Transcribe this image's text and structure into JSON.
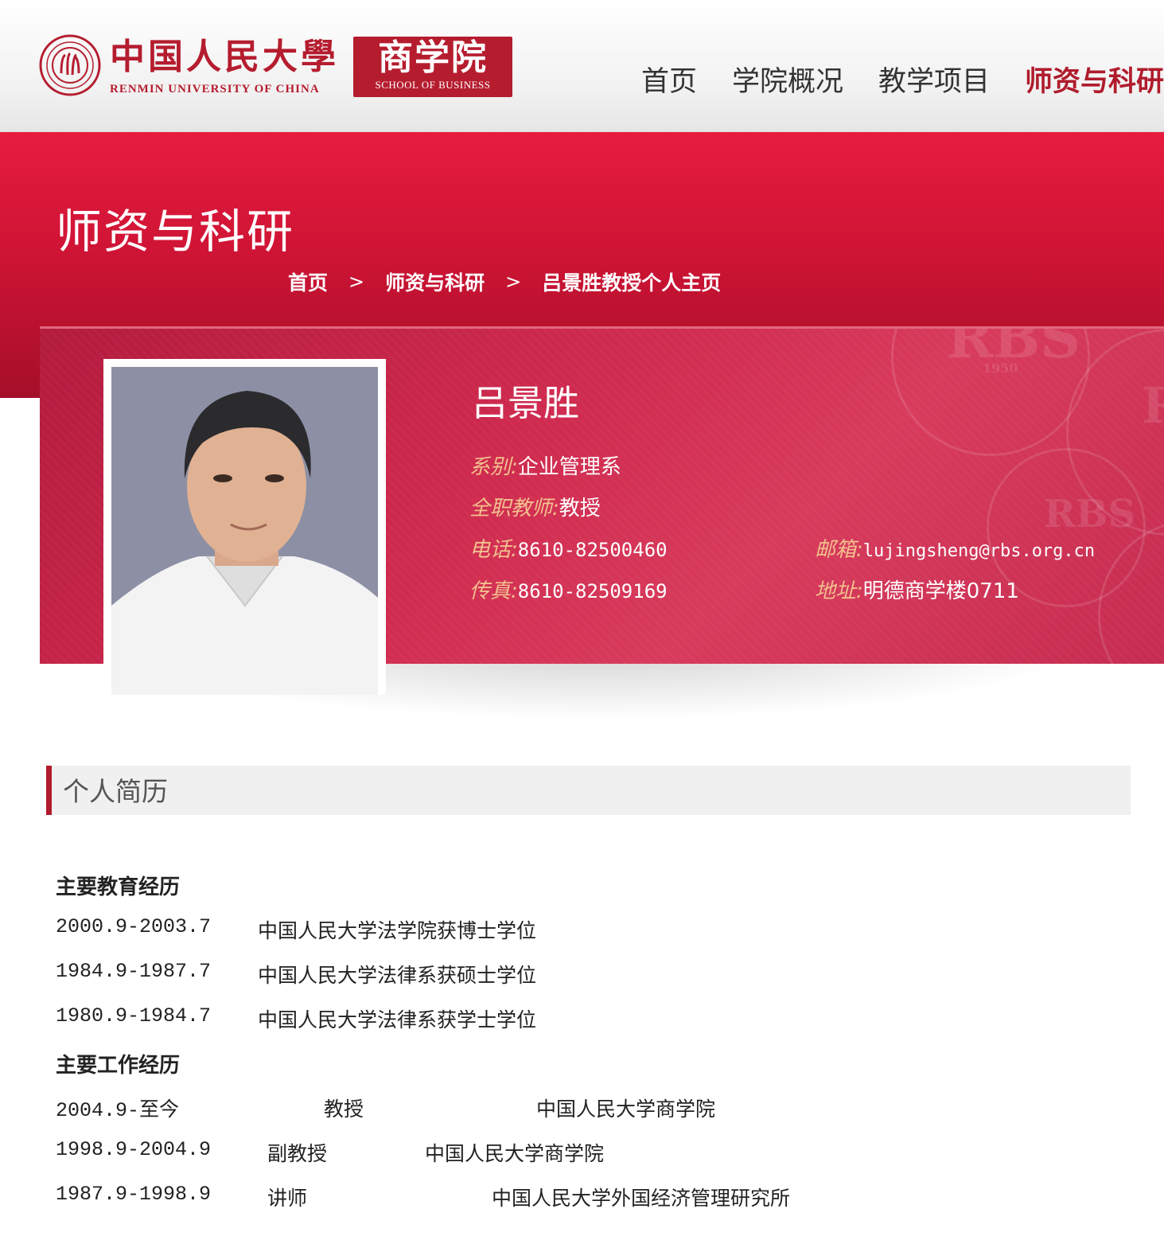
{
  "header": {
    "logo_cn": "中国人民大學",
    "logo_en": "RENMIN UNIVERSITY OF CHINA",
    "school_cn": "商学院",
    "school_en": "SCHOOL OF BUSINESS",
    "nav": [
      {
        "label": "首页",
        "active": false
      },
      {
        "label": "学院概况",
        "active": false
      },
      {
        "label": "教学项目",
        "active": false
      },
      {
        "label": "师资与科研",
        "active": true
      }
    ]
  },
  "banner": {
    "title": "师资与科研",
    "breadcrumb": [
      "首页",
      "师资与科研",
      "吕景胜教授个人主页"
    ],
    "separator": ">"
  },
  "profile": {
    "name": "吕景胜",
    "department_label": "系别:",
    "department": "企业管理系",
    "title_label": "全职教师:",
    "title": "教授",
    "phone_label": "电话:",
    "phone": "8610-82500460",
    "fax_label": "传真:",
    "fax": "8610-82509169",
    "email_label": "邮箱:",
    "email": "lujingsheng@rbs.org.cn",
    "address_label": "地址:",
    "address": "明德商学楼0711",
    "stamp_text": "RBS",
    "stamp_year": "1950"
  },
  "resume": {
    "section_title": "个人简历",
    "education_heading": "主要教育经历",
    "education": [
      {
        "date": "2000.9-2003.7",
        "desc": "中国人民大学法学院获博士学位"
      },
      {
        "date": "1984.9-1987.7",
        "desc": "中国人民大学法律系获硕士学位"
      },
      {
        "date": "1980.9-1984.7",
        "desc": "中国人民大学法律系获学士学位"
      }
    ],
    "work_heading": "主要工作经历",
    "work": [
      {
        "date": "2004.9-至今",
        "position": "教授",
        "org": "中国人民大学商学院"
      },
      {
        "date": "1998.9-2004.9",
        "position": "副教授",
        "org": "中国人民大学商学院"
      },
      {
        "date": "1987.9-1998.9",
        "position": "讲师",
        "org": "中国人民大学外国经济管理研究所"
      }
    ]
  },
  "colors": {
    "brand_red": "#b51d2f",
    "banner_red": "#d4153a",
    "label_gold": "#f2c08d"
  }
}
